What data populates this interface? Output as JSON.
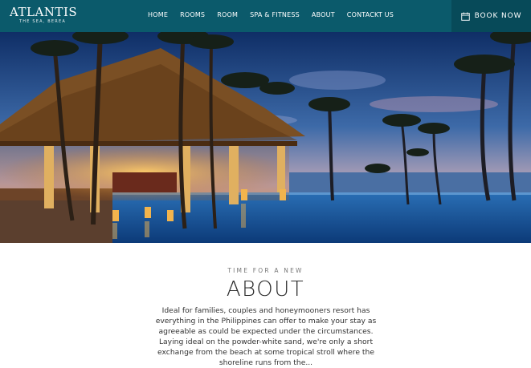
{
  "logo": {
    "title": "ATLANTIS",
    "subtitle": "THE SEA, BEREA"
  },
  "nav": {
    "items": [
      {
        "label": "HOME"
      },
      {
        "label": "ROOMS"
      },
      {
        "label": "ROOM"
      },
      {
        "label": "SPA & FITNESS"
      },
      {
        "label": "ABOUT"
      },
      {
        "label": "CONTACKT US"
      }
    ]
  },
  "book_button": {
    "label": "BOOK NOW",
    "icon": "calendar-icon"
  },
  "about": {
    "eyebrow": "TIME FOR A NEW",
    "heading": "ABOUT",
    "body": "Ideal for families, couples and honeymooners resort has everything in the Philippines can offer to make your stay as agreeable as could be expected under the circumstances. Laying ideal on the powder-white sand, we're only a short exchange from the beach at some tropical stroll where the shoreline runs from the..."
  },
  "colors": {
    "navbar": "#0b5a6b",
    "book_button": "#074a59",
    "text_dark": "#2b2b2b"
  }
}
